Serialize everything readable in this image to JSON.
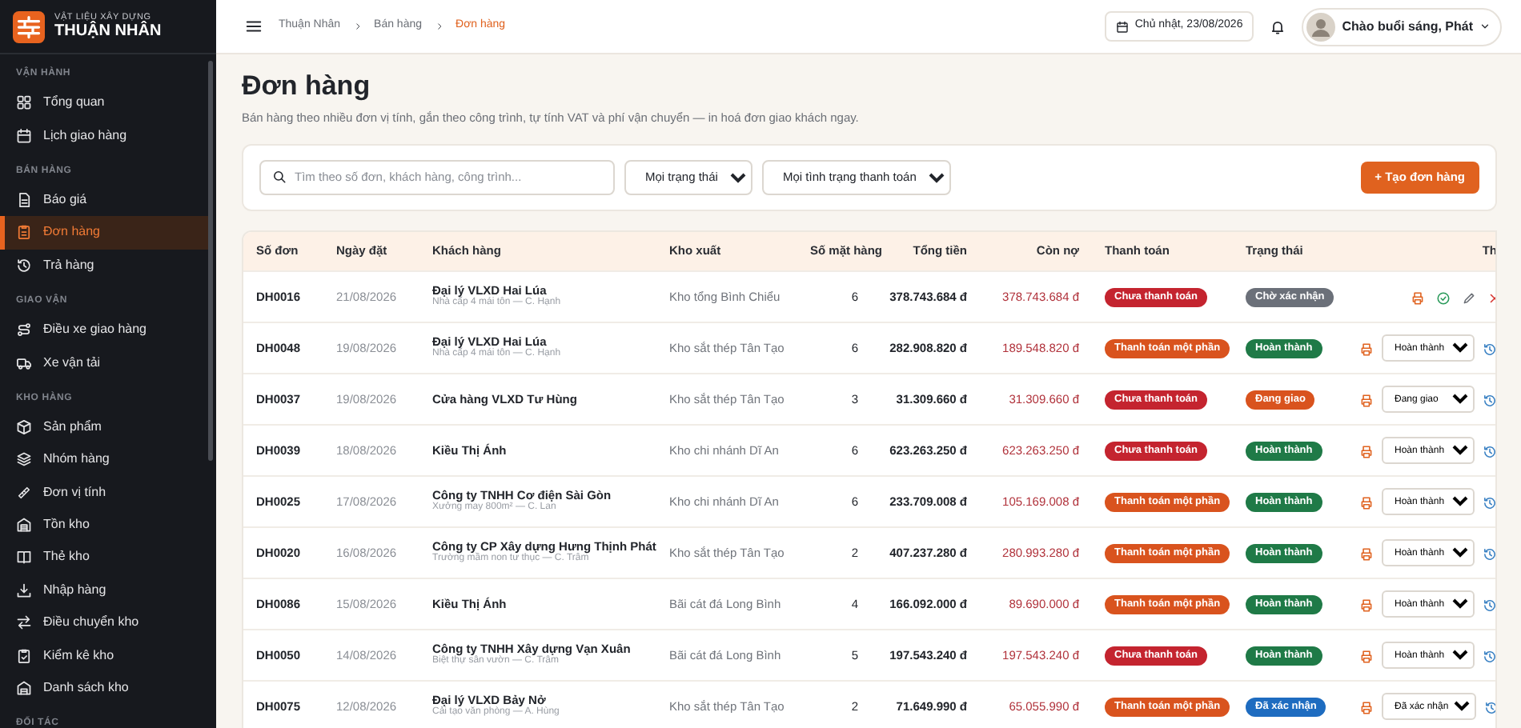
{
  "brand": {
    "tagline": "VẬT LIỆU XÂY DỰNG",
    "name": "THUẬN NHÂN"
  },
  "sidebar": {
    "sections": [
      {
        "title": "VẬN HÀNH",
        "items": [
          {
            "label": "Tổng quan",
            "selected": false
          },
          {
            "label": "Lịch giao hàng",
            "selected": false
          }
        ]
      },
      {
        "title": "BÁN HÀNG",
        "items": [
          {
            "label": "Báo giá",
            "selected": false
          },
          {
            "label": "Đơn hàng",
            "selected": true
          },
          {
            "label": "Trả hàng",
            "selected": false
          }
        ]
      },
      {
        "title": "GIAO VẬN",
        "items": [
          {
            "label": "Điều xe giao hàng",
            "selected": false
          },
          {
            "label": "Xe vận tải",
            "selected": false
          }
        ]
      },
      {
        "title": "KHO HÀNG",
        "items": [
          {
            "label": "Sản phẩm",
            "selected": false
          },
          {
            "label": "Nhóm hàng",
            "selected": false
          },
          {
            "label": "Đơn vị tính",
            "selected": false
          },
          {
            "label": "Tồn kho",
            "selected": false
          },
          {
            "label": "Thẻ kho",
            "selected": false
          },
          {
            "label": "Nhập hàng",
            "selected": false
          },
          {
            "label": "Điều chuyển kho",
            "selected": false
          },
          {
            "label": "Kiểm kê kho",
            "selected": false
          },
          {
            "label": "Danh sách kho",
            "selected": false
          }
        ]
      },
      {
        "title": "ĐỐI TÁC"
      }
    ]
  },
  "breadcrumb": [
    "Thuận Nhân",
    "Bán hàng",
    "Đơn hàng"
  ],
  "date": "Chủ nhật, 23/08/2026",
  "greeting": "Chào buổi sáng, Phát",
  "page": {
    "title": "Đơn hàng",
    "subtitle": "Bán hàng theo nhiều đơn vị tính, gắn theo công trình, tự tính VAT và phí vận chuyển — in hoá đơn giao khách ngay."
  },
  "filters": {
    "search_placeholder": "Tìm theo số đơn, khách hàng, công trình...",
    "status": "Mọi trạng thái",
    "payment": "Mọi tình trạng thanh toán",
    "create_button": "+ Tạo đơn hàng"
  },
  "table": {
    "columns": [
      "Số đơn",
      "Ngày đặt",
      "Khách hàng",
      "Kho xuất",
      "Số mặt hàng",
      "Tổng tiền",
      "Còn nợ",
      "Thanh toán",
      "Trạng thái",
      "Th"
    ],
    "rows": [
      {
        "code": "DH0016",
        "date": "21/08/2026",
        "customer": "Đại lý VLXD Hai Lúa",
        "note": "Nhà cấp 4 mái tôn — C. Hạnh",
        "warehouse": "Kho tổng Bình Chiểu",
        "items": "6",
        "total": "378.743.684 đ",
        "debt": "378.743.684 đ",
        "payment": {
          "label": "Chưa thanh toán",
          "color": "#c4242f"
        },
        "status": {
          "label": "Chờ xác nhận",
          "color": "#6b7079"
        },
        "actions": {
          "kind": "buttons"
        }
      },
      {
        "code": "DH0048",
        "date": "19/08/2026",
        "customer": "Đại lý VLXD Hai Lúa",
        "note": "Nhà cấp 4 mái tôn — C. Hạnh",
        "warehouse": "Kho sắt thép Tân Tạo",
        "items": "6",
        "total": "282.908.820 đ",
        "debt": "189.548.820 đ",
        "payment": {
          "label": "Thanh toán một phần",
          "color": "#d9531e"
        },
        "status": {
          "label": "Hoàn thành",
          "color": "#1f7a47"
        },
        "actions": {
          "kind": "select",
          "value": "Hoàn thành"
        }
      },
      {
        "code": "DH0037",
        "date": "19/08/2026",
        "customer": "Cửa hàng VLXD Tư Hùng",
        "warehouse": "Kho sắt thép Tân Tạo",
        "items": "3",
        "total": "31.309.660 đ",
        "debt": "31.309.660 đ",
        "payment": {
          "label": "Chưa thanh toán",
          "color": "#c4242f"
        },
        "status": {
          "label": "Đang giao",
          "color": "#d9531e"
        },
        "actions": {
          "kind": "select",
          "value": "Đang giao"
        }
      },
      {
        "code": "DH0039",
        "date": "18/08/2026",
        "customer": "Kiều Thị Ánh",
        "warehouse": "Kho chi nhánh Dĩ An",
        "items": "6",
        "total": "623.263.250 đ",
        "debt": "623.263.250 đ",
        "payment": {
          "label": "Chưa thanh toán",
          "color": "#c4242f"
        },
        "status": {
          "label": "Hoàn thành",
          "color": "#1f7a47"
        },
        "actions": {
          "kind": "select",
          "value": "Hoàn thành"
        }
      },
      {
        "code": "DH0025",
        "date": "17/08/2026",
        "customer": "Công ty TNHH Cơ điện Sài Gòn",
        "note": "Xưởng may 800m² — C. Lan",
        "warehouse": "Kho chi nhánh Dĩ An",
        "items": "6",
        "total": "233.709.008 đ",
        "debt": "105.169.008 đ",
        "payment": {
          "label": "Thanh toán một phần",
          "color": "#d9531e"
        },
        "status": {
          "label": "Hoàn thành",
          "color": "#1f7a47"
        },
        "actions": {
          "kind": "select",
          "value": "Hoàn thành"
        }
      },
      {
        "code": "DH0020",
        "date": "16/08/2026",
        "customer": "Công ty CP Xây dựng Hưng Thịnh Phát",
        "note": "Trường mầm non tư thục — C. Trâm",
        "warehouse": "Kho sắt thép Tân Tạo",
        "items": "2",
        "total": "407.237.280 đ",
        "debt": "280.993.280 đ",
        "payment": {
          "label": "Thanh toán một phần",
          "color": "#d9531e"
        },
        "status": {
          "label": "Hoàn thành",
          "color": "#1f7a47"
        },
        "actions": {
          "kind": "select",
          "value": "Hoàn thành"
        }
      },
      {
        "code": "DH0086",
        "date": "15/08/2026",
        "customer": "Kiều Thị Ánh",
        "warehouse": "Bãi cát đá Long Bình",
        "items": "4",
        "total": "166.092.000 đ",
        "debt": "89.690.000 đ",
        "payment": {
          "label": "Thanh toán một phần",
          "color": "#d9531e"
        },
        "status": {
          "label": "Hoàn thành",
          "color": "#1f7a47"
        },
        "actions": {
          "kind": "select",
          "value": "Hoàn thành"
        }
      },
      {
        "code": "DH0050",
        "date": "14/08/2026",
        "customer": "Công ty TNHH Xây dựng Vạn Xuân",
        "note": "Biệt thự sân vườn — C. Trâm",
        "warehouse": "Bãi cát đá Long Bình",
        "items": "5",
        "total": "197.543.240 đ",
        "debt": "197.543.240 đ",
        "payment": {
          "label": "Chưa thanh toán",
          "color": "#c4242f"
        },
        "status": {
          "label": "Hoàn thành",
          "color": "#1f7a47"
        },
        "actions": {
          "kind": "select",
          "value": "Hoàn thành"
        }
      },
      {
        "code": "DH0075",
        "date": "12/08/2026",
        "customer": "Đại lý VLXD Bảy Nở",
        "note": "Cải tạo văn phòng — A. Hùng",
        "warehouse": "Kho sắt thép Tân Tạo",
        "items": "2",
        "total": "71.649.990 đ",
        "debt": "65.055.990 đ",
        "payment": {
          "label": "Thanh toán một phần",
          "color": "#d9531e"
        },
        "status": {
          "label": "Đã xác nhận",
          "color": "#1e6cc0"
        },
        "actions": {
          "kind": "select",
          "value": "Đã xác nhận"
        }
      }
    ]
  }
}
